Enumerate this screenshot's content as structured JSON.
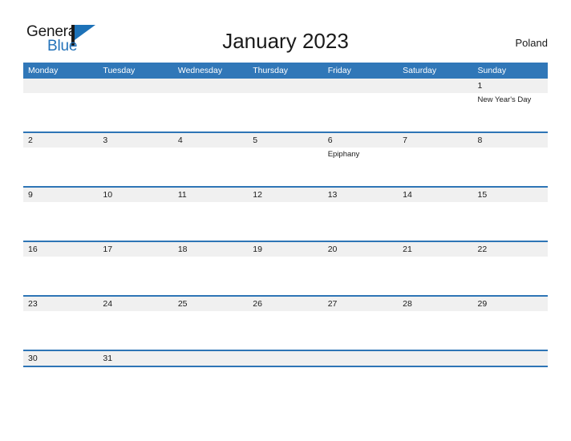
{
  "brand": {
    "word_one": "General",
    "word_two": "Blue",
    "accent_color": "#1d72b8",
    "text_color": "#1a1a1a"
  },
  "header": {
    "title": "January 2023",
    "country": "Poland"
  },
  "calendar": {
    "header_bg": "#3077b8",
    "row_band_bg": "#f0f0f0",
    "row_border_color": "#2e75b6",
    "weekdays": [
      "Monday",
      "Tuesday",
      "Wednesday",
      "Thursday",
      "Friday",
      "Saturday",
      "Sunday"
    ],
    "weeks": [
      [
        {
          "date": "",
          "event": ""
        },
        {
          "date": "",
          "event": ""
        },
        {
          "date": "",
          "event": ""
        },
        {
          "date": "",
          "event": ""
        },
        {
          "date": "",
          "event": ""
        },
        {
          "date": "",
          "event": ""
        },
        {
          "date": "1",
          "event": "New Year's Day"
        }
      ],
      [
        {
          "date": "2",
          "event": ""
        },
        {
          "date": "3",
          "event": ""
        },
        {
          "date": "4",
          "event": ""
        },
        {
          "date": "5",
          "event": ""
        },
        {
          "date": "6",
          "event": "Epiphany"
        },
        {
          "date": "7",
          "event": ""
        },
        {
          "date": "8",
          "event": ""
        }
      ],
      [
        {
          "date": "9",
          "event": ""
        },
        {
          "date": "10",
          "event": ""
        },
        {
          "date": "11",
          "event": ""
        },
        {
          "date": "12",
          "event": ""
        },
        {
          "date": "13",
          "event": ""
        },
        {
          "date": "14",
          "event": ""
        },
        {
          "date": "15",
          "event": ""
        }
      ],
      [
        {
          "date": "16",
          "event": ""
        },
        {
          "date": "17",
          "event": ""
        },
        {
          "date": "18",
          "event": ""
        },
        {
          "date": "19",
          "event": ""
        },
        {
          "date": "20",
          "event": ""
        },
        {
          "date": "21",
          "event": ""
        },
        {
          "date": "22",
          "event": ""
        }
      ],
      [
        {
          "date": "23",
          "event": ""
        },
        {
          "date": "24",
          "event": ""
        },
        {
          "date": "25",
          "event": ""
        },
        {
          "date": "26",
          "event": ""
        },
        {
          "date": "27",
          "event": ""
        },
        {
          "date": "28",
          "event": ""
        },
        {
          "date": "29",
          "event": ""
        }
      ],
      [
        {
          "date": "30",
          "event": ""
        },
        {
          "date": "31",
          "event": ""
        },
        {
          "date": "",
          "event": ""
        },
        {
          "date": "",
          "event": ""
        },
        {
          "date": "",
          "event": ""
        },
        {
          "date": "",
          "event": ""
        },
        {
          "date": "",
          "event": ""
        }
      ]
    ]
  }
}
